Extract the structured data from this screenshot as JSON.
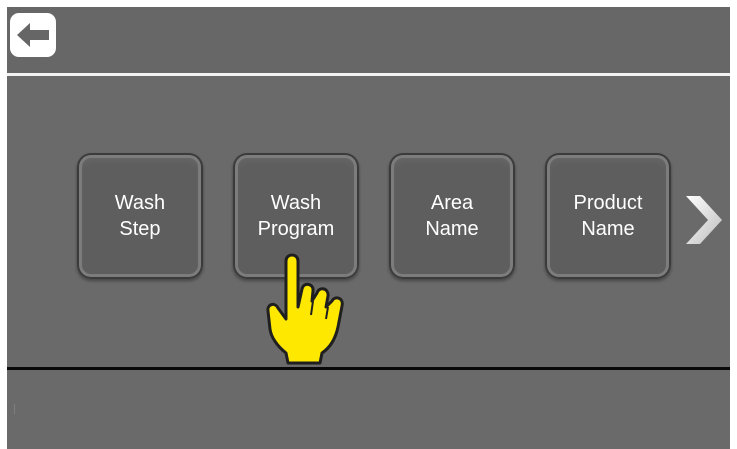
{
  "header": {
    "back_label": "Back"
  },
  "menu": {
    "tiles": [
      {
        "label": "Wash\nStep"
      },
      {
        "label": "Wash\nProgram"
      },
      {
        "label": "Area\nName"
      },
      {
        "label": "Product\nName"
      }
    ]
  },
  "colors": {
    "background": "#6a6a6a",
    "tile": "#5e5e5e",
    "text": "#ffffff",
    "pointer": "#ffe800"
  },
  "icons": {
    "back": "arrow-left-icon",
    "next": "chevron-right-icon",
    "pointer": "pointing-hand-icon"
  }
}
